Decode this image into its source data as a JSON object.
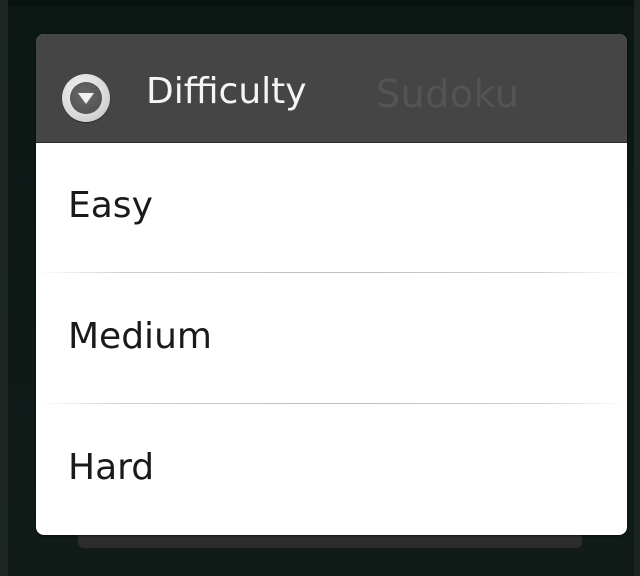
{
  "background_app": {
    "title": "Sudoku"
  },
  "dialog": {
    "title": "Difficulty",
    "icon": "dropdown-arrow-icon",
    "options": [
      {
        "label": "Easy"
      },
      {
        "label": "Medium"
      },
      {
        "label": "Hard"
      }
    ]
  },
  "colors": {
    "header_bg": "#454545",
    "dialog_bg": "#ffffff",
    "option_text": "#1a1a1a",
    "screen_bg": "#101a17"
  }
}
